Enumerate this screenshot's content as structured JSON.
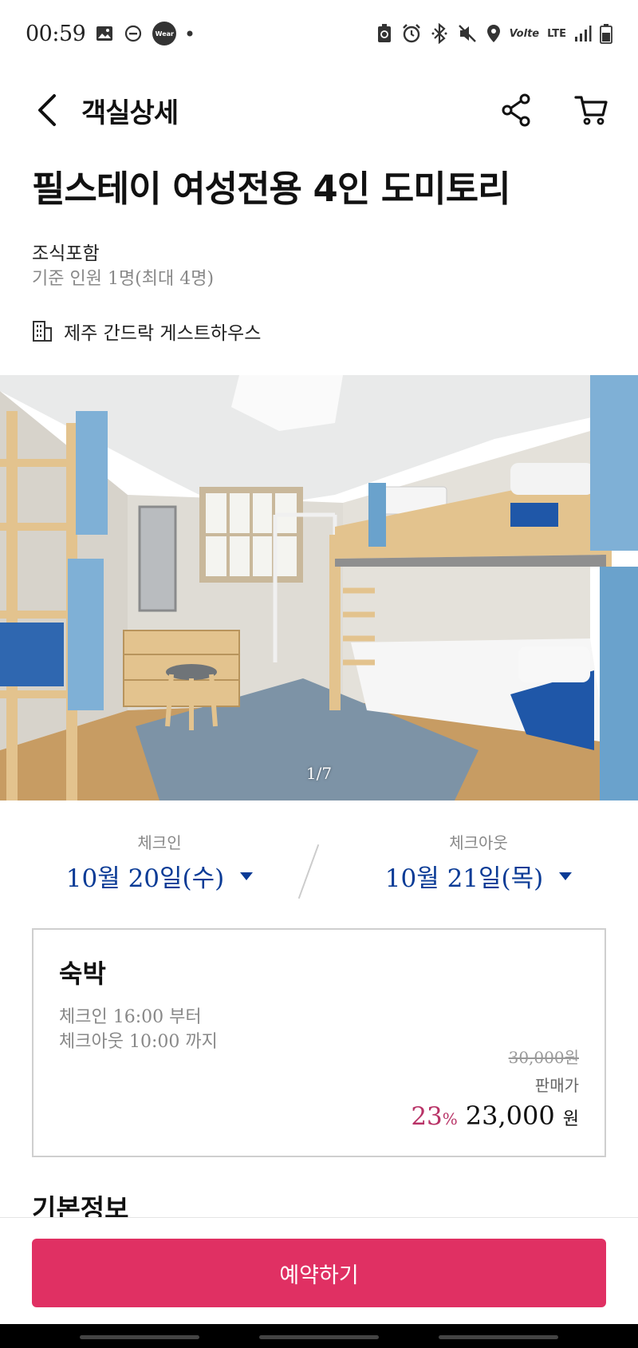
{
  "status_bar": {
    "time": "00:59",
    "left_icons": [
      "image-icon",
      "dnd-icon",
      "wear-icon",
      "dot-icon"
    ],
    "wear_label": "Wear",
    "volte_label": "Volte",
    "lte_label": "LTE",
    "right_icons": [
      "battery-saver-icon",
      "alarm-icon",
      "bluetooth-icon",
      "mute-icon",
      "location-icon",
      "volte-icon",
      "lte-icon",
      "signal-icon",
      "battery-icon"
    ]
  },
  "app_bar": {
    "title": "객실상세",
    "back_icon": "back-arrow-icon",
    "share_icon": "share-icon",
    "cart_icon": "cart-icon"
  },
  "room": {
    "title": "필스테이 여성전용 4인 도미토리",
    "meal": "조식포함",
    "capacity": "기준 인원 1명(최대 4명)",
    "property_icon": "building-icon",
    "property_name": "제주 간드락 게스트하우스"
  },
  "photo": {
    "counter": "1/7"
  },
  "dates": {
    "checkin_label": "체크인",
    "checkin_value": "10월 20일(수)",
    "checkout_label": "체크아웃",
    "checkout_value": "10월 21일(목)"
  },
  "stay": {
    "type": "숙박",
    "checkin_time": "체크인  16:00 부터",
    "checkout_time": "체크아웃  10:00 까지",
    "original_price": "30,000원",
    "price_label": "판매가",
    "discount_value": "23",
    "discount_unit": "%",
    "final_price": "23,000",
    "currency": "원"
  },
  "sections": {
    "basic_info": "기본정보"
  },
  "cta": {
    "reserve_label": "예약하기"
  },
  "colors": {
    "accent": "#e03063",
    "date_blue": "#0a3b96",
    "discount": "#b83266"
  }
}
